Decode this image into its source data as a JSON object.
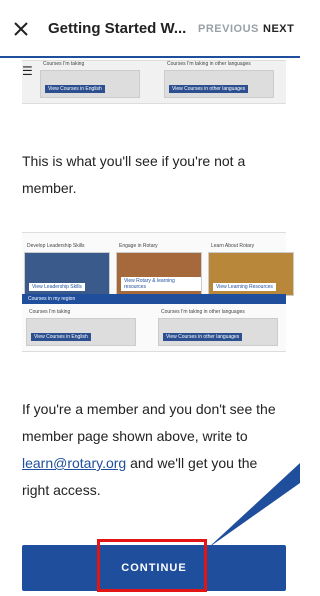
{
  "topbar": {
    "close_icon": "close-icon",
    "title": "Getting Started W...",
    "previous": "PREVIOUS",
    "next": "NEXT"
  },
  "preview_top": {
    "left_caption": "Courses I'm taking",
    "right_caption": "Courses I'm taking in other languages",
    "left_button": "View Courses in English",
    "right_button": "View Courses in other languages",
    "menu_icon": "hamburger-icon"
  },
  "text": {
    "not_member": "This is what you'll see if you're not a member.",
    "member_prefix": "If you're a member and you don't see the member page shown above, write to ",
    "email": "learn@rotary.org",
    "member_suffix": " and we'll get you the right access."
  },
  "preview_mid": {
    "caps": [
      "Develop Leadership Skills",
      "Engage in Rotary",
      "Learn About Rotary"
    ],
    "tags": [
      "View Leadership Skills",
      "View Rotary & learning resources",
      "View Learning Resources"
    ],
    "banner": "Courses in my region",
    "left_caption": "Courses I'm taking",
    "right_caption": "Courses I'm taking in other languages",
    "left_button": "View Courses in English",
    "right_button": "View Courses in other languages"
  },
  "button": {
    "continue": "CONTINUE"
  },
  "colors": {
    "accent": "#1f4e9c",
    "highlight": "#e21414"
  }
}
